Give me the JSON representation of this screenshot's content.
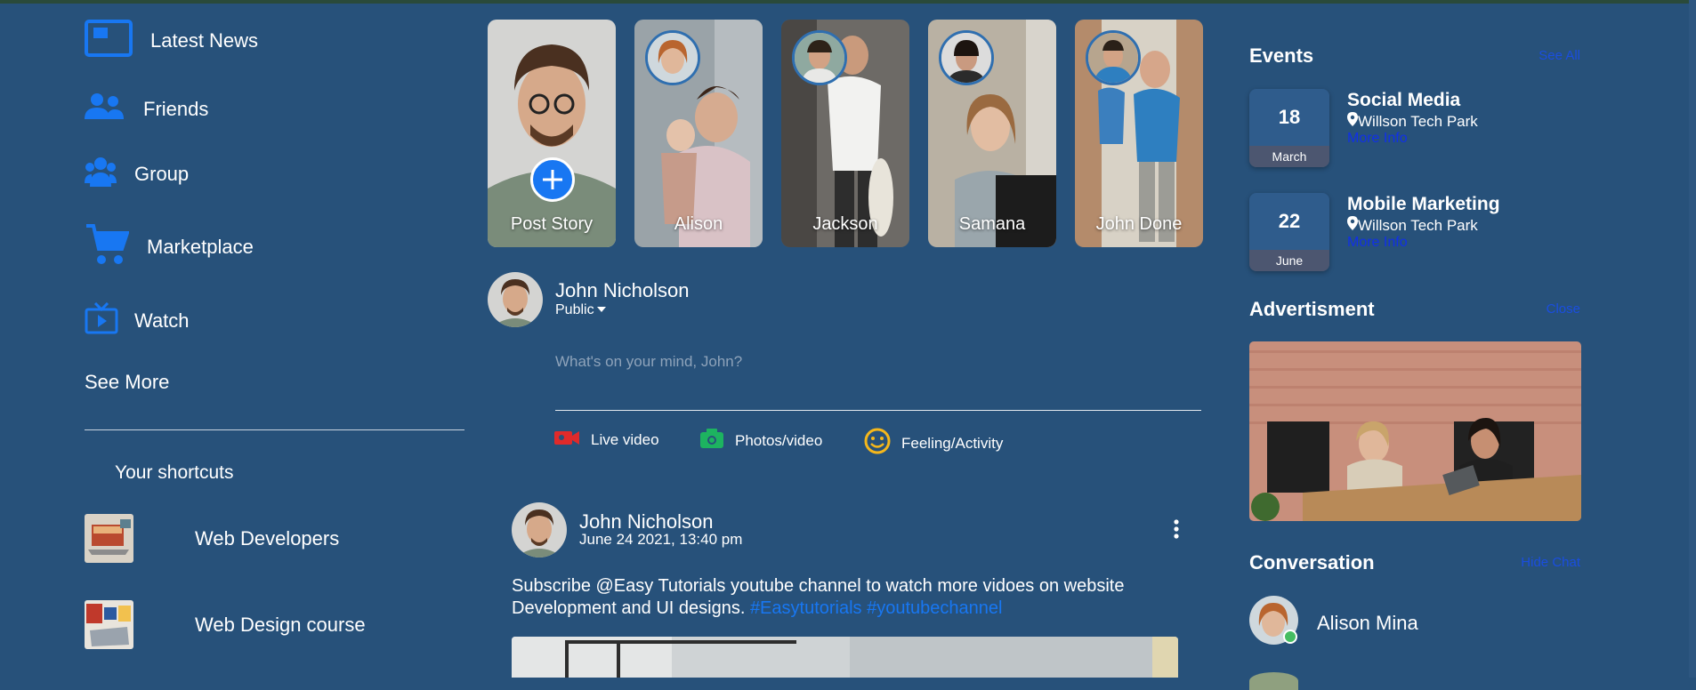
{
  "sidebar": {
    "items": [
      {
        "label": "Latest News",
        "icon": "news-icon"
      },
      {
        "label": "Friends",
        "icon": "friends-icon"
      },
      {
        "label": "Group",
        "icon": "group-icon"
      },
      {
        "label": "Marketplace",
        "icon": "cart-icon"
      },
      {
        "label": "Watch",
        "icon": "watch-icon"
      }
    ],
    "see_more": "See More",
    "shortcuts_title": "Your shortcuts",
    "shortcuts": [
      {
        "label": "Web Developers"
      },
      {
        "label": "Web Design course"
      }
    ]
  },
  "stories": [
    {
      "name": "Post Story"
    },
    {
      "name": "Alison"
    },
    {
      "name": "Jackson"
    },
    {
      "name": "Samana"
    },
    {
      "name": "John Done"
    }
  ],
  "composer": {
    "user_name": "John Nicholson",
    "privacy": "Public",
    "placeholder": "What's on your mind, John?",
    "actions": [
      {
        "label": "Live video",
        "icon": "live-video-icon",
        "color": "#e02a2a"
      },
      {
        "label": "Photos/video",
        "icon": "camera-icon",
        "color": "#1db360"
      },
      {
        "label": "Feeling/Activity",
        "icon": "smiley-icon",
        "color": "#f5b71b"
      }
    ]
  },
  "post": {
    "author": "John Nicholson",
    "date": "June 24 2021, 13:40 pm",
    "text": "Subscribe @Easy Tutorials youtube channel to watch more vidoes on website Development and UI designs.",
    "tags": "#Easytutorials #youtubechannel"
  },
  "right": {
    "events_title": "Events",
    "events_link": "See All",
    "events": [
      {
        "day": "18",
        "month": "March",
        "title": "Social Media",
        "location": "Willson Tech Park",
        "more": "More Info"
      },
      {
        "day": "22",
        "month": "June",
        "title": "Mobile Marketing",
        "location": "Willson Tech Park",
        "more": "More Info"
      }
    ],
    "ad_title": "Advertisment",
    "ad_link": "Close",
    "conversation_title": "Conversation",
    "conversation_link": "Hide Chat",
    "contacts": [
      {
        "name": "Alison Mina",
        "online": true
      }
    ]
  },
  "colors": {
    "background": "#27517a",
    "accent": "#1877f2",
    "link": "#1030e8"
  }
}
